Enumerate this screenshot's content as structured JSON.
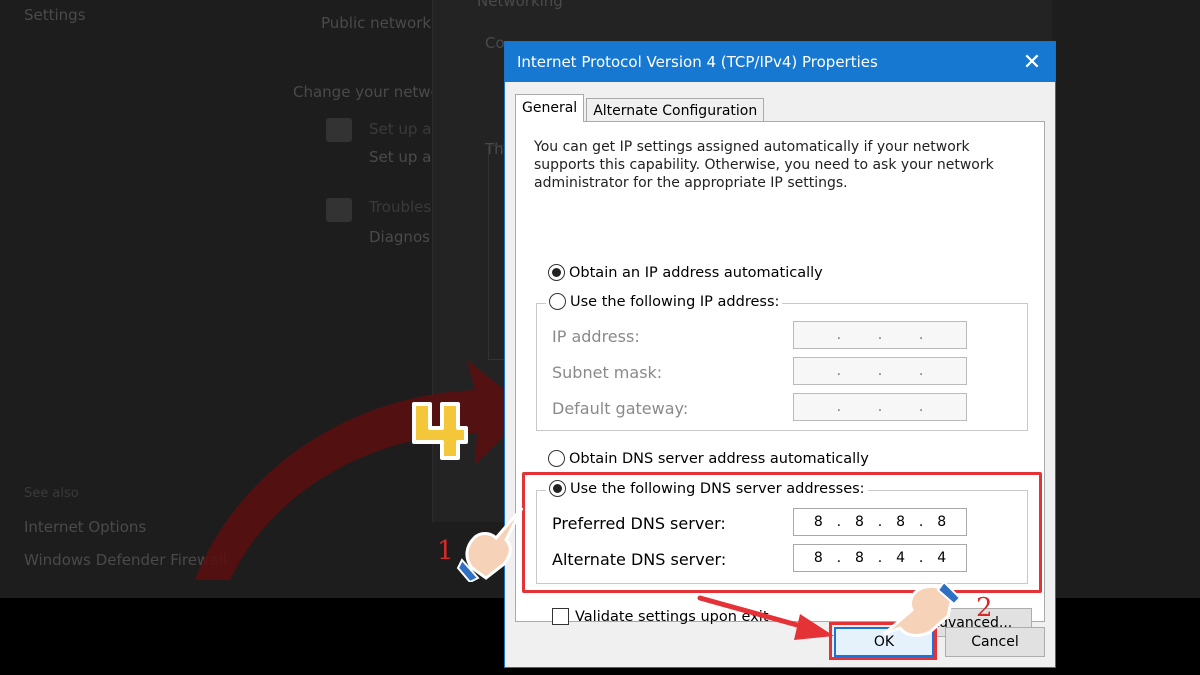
{
  "background": {
    "texts": [
      "Settings",
      "Public network",
      "Change your netwo",
      "Set up a",
      "Set up a",
      "Troubles",
      "Diagnos",
      "Networking",
      "Co",
      "The",
      "Internet Options",
      "Windows Defender Firewall",
      "See also"
    ]
  },
  "dialog": {
    "title": "Internet Protocol Version 4 (TCP/IPv4) Properties",
    "close_label": "✕",
    "tabs": [
      {
        "label": "General",
        "active": true
      },
      {
        "label": "Alternate Configuration",
        "active": false
      }
    ],
    "intro": "You can get IP settings assigned automatically if your network supports this capability. Otherwise, you need to ask your network administrator for the appropriate IP settings.",
    "ip_mode": {
      "auto_label": "Obtain an IP address automatically",
      "auto_selected": true,
      "manual_label": "Use the following IP address:",
      "manual_selected": false
    },
    "ip_fields": [
      {
        "label": "IP address:",
        "value": [
          "",
          "",
          "",
          ""
        ]
      },
      {
        "label": "Subnet mask:",
        "value": [
          "",
          "",
          "",
          ""
        ]
      },
      {
        "label": "Default gateway:",
        "value": [
          "",
          "",
          "",
          ""
        ]
      }
    ],
    "dns_mode": {
      "auto_label": "Obtain DNS server address automatically",
      "auto_selected": false,
      "manual_label": "Use the following DNS server addresses:",
      "manual_selected": true
    },
    "dns_fields": [
      {
        "label": "Preferred DNS server:",
        "value": [
          "8",
          "8",
          "8",
          "8"
        ]
      },
      {
        "label": "Alternate DNS server:",
        "value": [
          "8",
          "8",
          "4",
          "4"
        ]
      }
    ],
    "validate_label": "Validate settings upon exit",
    "validate_checked": false,
    "advanced_label": "Advanced...",
    "ok_label": "OK",
    "cancel_label": "Cancel"
  },
  "annotations": {
    "step_1": "1",
    "step_2": "2",
    "step_4": "4"
  },
  "colors": {
    "titlebar": "#1778d2",
    "highlight": "#e53237",
    "annotation_text": "#d42a2a",
    "badge_fill": "#f4c73b"
  }
}
